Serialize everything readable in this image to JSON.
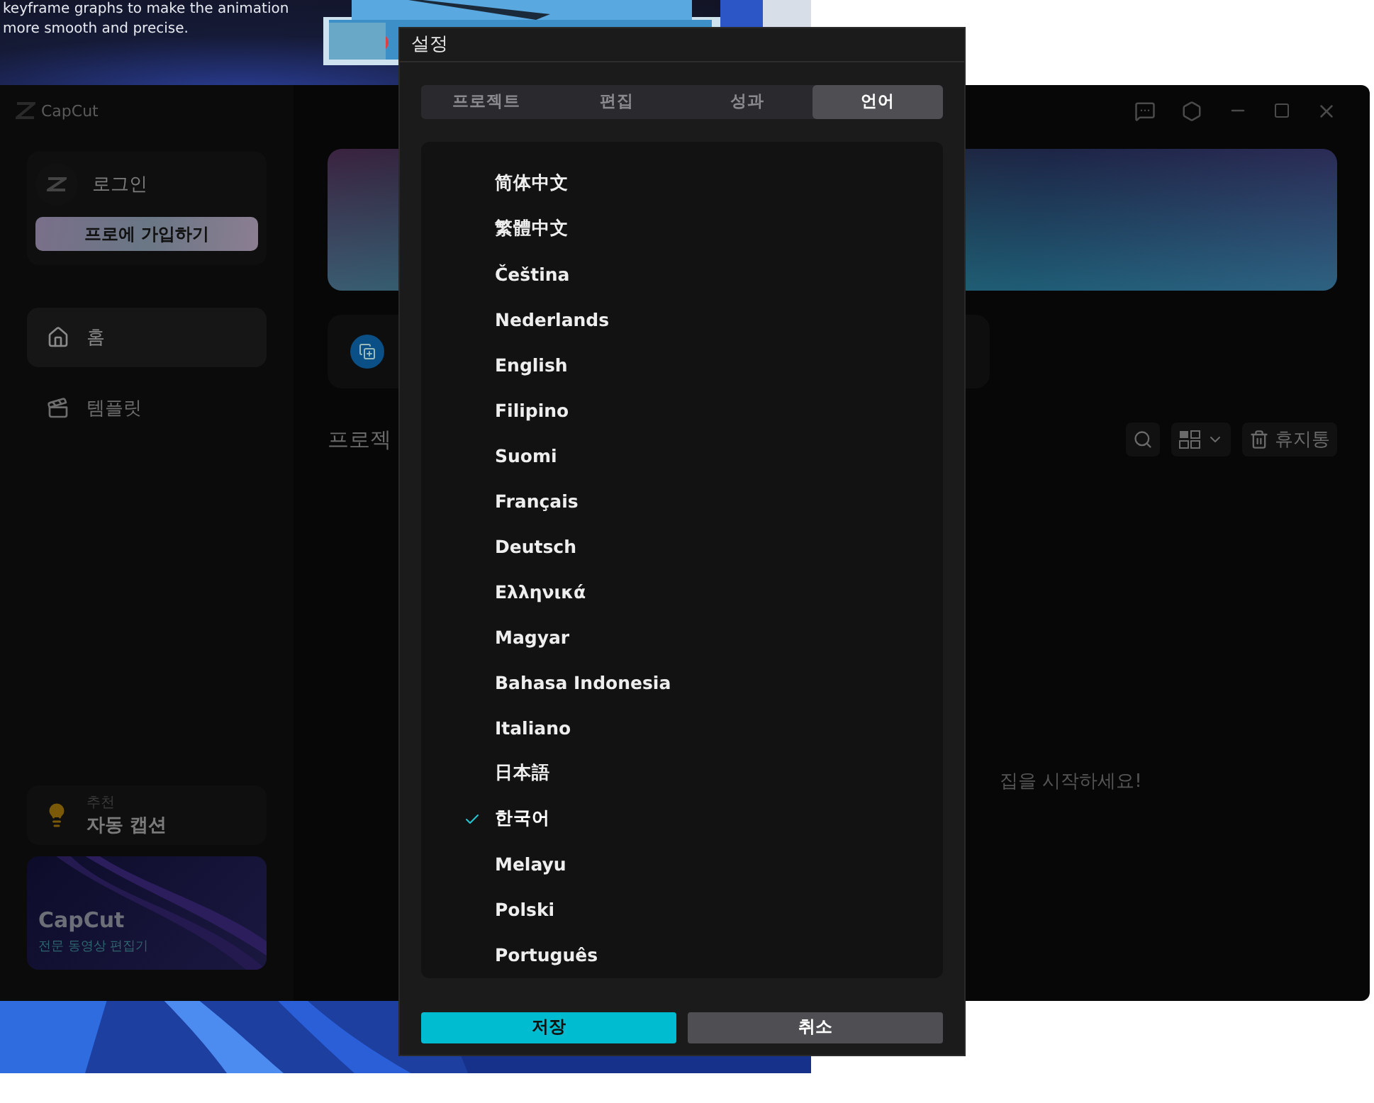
{
  "banner": {
    "lines": [
      "keyframe graphs to make the animation",
      "more smooth and precise."
    ]
  },
  "app_window": {
    "logo": "CapCut",
    "sidebar": {
      "login": "로그인",
      "pro_button": "프로에 가입하기",
      "nav": [
        {
          "label": "홈",
          "selected": true
        },
        {
          "label": "템플릿",
          "selected": false
        }
      ],
      "tip": {
        "caption": "추천",
        "title": "자동 캡션"
      },
      "promo": {
        "title": "CapCut",
        "subtitle": "전문 동영상 편집기"
      }
    },
    "projects": {
      "heading": "프로젝",
      "trash": "휴지통",
      "empty_message": "집을 시작하세요!"
    }
  },
  "dialog": {
    "title": "설정",
    "tabs": [
      {
        "label": "프로젝트",
        "selected": false
      },
      {
        "label": "편집",
        "selected": false
      },
      {
        "label": "성과",
        "selected": false
      },
      {
        "label": "언어",
        "selected": true
      }
    ],
    "languages": [
      {
        "label": "简体中文",
        "selected": false
      },
      {
        "label": "繁體中文",
        "selected": false
      },
      {
        "label": "Čeština",
        "selected": false
      },
      {
        "label": "Nederlands",
        "selected": false
      },
      {
        "label": "English",
        "selected": false
      },
      {
        "label": "Filipino",
        "selected": false
      },
      {
        "label": "Suomi",
        "selected": false
      },
      {
        "label": "Français",
        "selected": false
      },
      {
        "label": "Deutsch",
        "selected": false
      },
      {
        "label": "Ελληνικά",
        "selected": false
      },
      {
        "label": "Magyar",
        "selected": false
      },
      {
        "label": "Bahasa Indonesia",
        "selected": false
      },
      {
        "label": "Italiano",
        "selected": false
      },
      {
        "label": "日本語",
        "selected": false
      },
      {
        "label": "한국어",
        "selected": true
      },
      {
        "label": "Melayu",
        "selected": false
      },
      {
        "label": "Polski",
        "selected": false
      },
      {
        "label": "Português",
        "selected": false
      }
    ],
    "buttons": [
      {
        "label": "저장",
        "kind": "primary"
      },
      {
        "label": "취소",
        "kind": "secondary"
      }
    ]
  }
}
